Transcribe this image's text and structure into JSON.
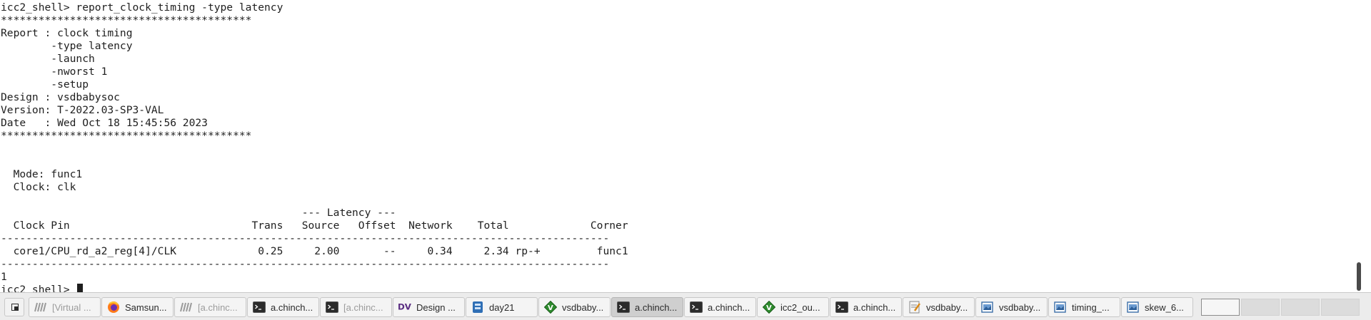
{
  "terminal": {
    "lines": [
      "icc2_shell> report_clock_timing -type latency",
      "****************************************",
      "Report : clock timing",
      "        -type latency",
      "        -launch",
      "        -nworst 1",
      "        -setup",
      "Design : vsdbabysoc",
      "Version: T-2022.03-SP3-VAL",
      "Date   : Wed Oct 18 15:45:56 2023",
      "****************************************",
      "",
      "",
      "  Mode: func1",
      "  Clock: clk",
      "",
      "                                                --- Latency ---",
      "  Clock Pin                             Trans   Source   Offset  Network    Total             Corner",
      "-------------------------------------------------------------------------------------------------",
      "  core1/CPU_rd_a2_reg[4]/CLK             0.25     2.00       --     0.34     2.34 rp-+         func1",
      "-------------------------------------------------------------------------------------------------",
      "1"
    ],
    "prompt": "icc2_shell> "
  },
  "taskbar": {
    "tasks": [
      {
        "label": "[Virtual ...",
        "icon": "virtualbox-icon",
        "state": "dim"
      },
      {
        "label": "Samsun...",
        "icon": "firefox-icon",
        "state": "normal"
      },
      {
        "label": "[a.chinc...",
        "icon": "virtualbox-icon",
        "state": "dim"
      },
      {
        "label": "a.chinch...",
        "icon": "terminal-icon",
        "state": "normal"
      },
      {
        "label": "[a.chinc...",
        "icon": "terminal-icon",
        "state": "dim"
      },
      {
        "label": "Design ...",
        "icon": "dv-icon",
        "state": "normal"
      },
      {
        "label": "day21",
        "icon": "file-manager-icon",
        "state": "normal"
      },
      {
        "label": "vsdbaby...",
        "icon": "gvim-icon",
        "state": "normal"
      },
      {
        "label": "a.chinch...",
        "icon": "terminal-icon",
        "state": "active"
      },
      {
        "label": "a.chinch...",
        "icon": "terminal-icon",
        "state": "normal"
      },
      {
        "label": "icc2_ou...",
        "icon": "gvim-icon",
        "state": "normal"
      },
      {
        "label": "a.chinch...",
        "icon": "terminal-icon",
        "state": "normal"
      },
      {
        "label": "vsdbaby...",
        "icon": "text-editor-icon",
        "state": "normal"
      },
      {
        "label": "vsdbaby...",
        "icon": "image-viewer-icon",
        "state": "normal"
      },
      {
        "label": "timing_...",
        "icon": "image-viewer-icon",
        "state": "normal"
      },
      {
        "label": "skew_6...",
        "icon": "image-viewer-icon",
        "state": "normal"
      }
    ],
    "workspaces": 4,
    "current_workspace": 1
  }
}
